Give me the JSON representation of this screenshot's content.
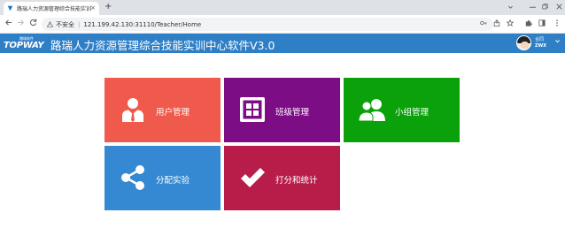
{
  "browser": {
    "tab_title": "路瑞人力资源管理综合技能实训",
    "tab_close": "×",
    "new_tab": "+",
    "security_label": "不安全",
    "url": "121.199.42.130:31110/Teacher/Home"
  },
  "app": {
    "logo_small": "踏瑞软件",
    "logo_big": "TOPWAY",
    "title": "路瑞人力资源管理综合技能实训中心软件V3.0",
    "user_name": "合同",
    "user_sub": "ZWX"
  },
  "tiles": [
    {
      "label": "用户管理",
      "color": "#ef5a4c",
      "icon": "user-tie-icon"
    },
    {
      "label": "班级管理",
      "color": "#7d0d84",
      "icon": "grid-icon"
    },
    {
      "label": "小组管理",
      "color": "#0aa10a",
      "icon": "group-icon"
    },
    {
      "label": "分配实验",
      "color": "#3489d2",
      "icon": "share-icon"
    },
    {
      "label": "打分和统计",
      "color": "#b81d4a",
      "icon": "checkmark-icon"
    }
  ]
}
